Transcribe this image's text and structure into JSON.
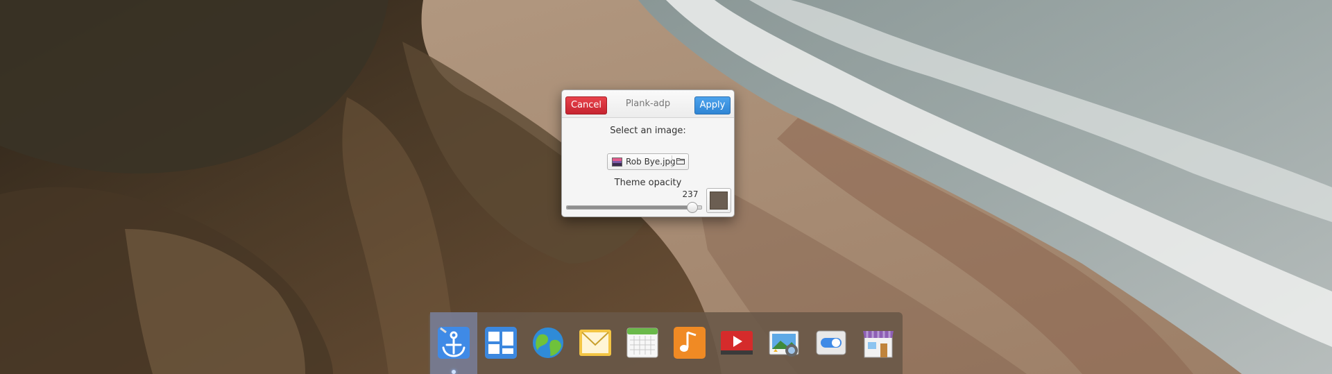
{
  "dialog": {
    "title": "Plank-adp",
    "cancel_label": "Cancel",
    "apply_label": "Apply",
    "select_image_label": "Select an image:",
    "file": {
      "name": "Rob Bye.jpg",
      "thumbnail_icon": "image-file-icon",
      "browse_icon": "folder-icon"
    },
    "opacity": {
      "label": "Theme opacity",
      "value": "237",
      "max": 255,
      "fraction": 0.93
    },
    "color_swatch": "#6b5e52"
  },
  "dock": {
    "items": [
      {
        "name": "plank-preferences-icon",
        "active": true
      },
      {
        "name": "workspaces-icon",
        "active": false
      },
      {
        "name": "web-browser-icon",
        "active": false
      },
      {
        "name": "mail-icon",
        "active": false
      },
      {
        "name": "calendar-icon",
        "active": false
      },
      {
        "name": "music-icon",
        "active": false
      },
      {
        "name": "videos-icon",
        "active": false
      },
      {
        "name": "photos-icon",
        "active": false
      },
      {
        "name": "system-settings-icon",
        "active": false
      },
      {
        "name": "app-center-icon",
        "active": false
      }
    ]
  },
  "colors": {
    "cancel": "#c62430",
    "apply": "#2f85d4",
    "dock_background": "#695848",
    "active_highlight": "#8296c8"
  }
}
